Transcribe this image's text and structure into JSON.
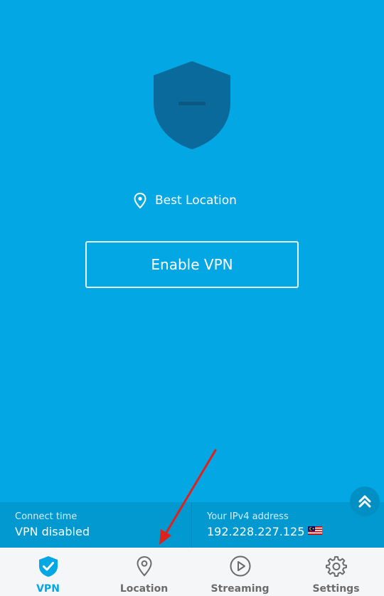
{
  "status": {
    "location_label": "Best Location",
    "enable_button_label": "Enable VPN"
  },
  "info_bar": {
    "connect_time_label": "Connect time",
    "connect_time_value": "VPN disabled",
    "ip_label": "Your IPv4 address",
    "ip_value": "192.228.227.125",
    "flag_icon": "malaysia-flag-icon"
  },
  "nav": {
    "items": [
      {
        "label": "VPN",
        "icon": "vpn-shield-check-icon",
        "active": true
      },
      {
        "label": "Location",
        "icon": "location-pin-icon",
        "active": false
      },
      {
        "label": "Streaming",
        "icon": "play-circle-icon",
        "active": false
      },
      {
        "label": "Settings",
        "icon": "gear-icon",
        "active": false
      }
    ]
  },
  "colors": {
    "background": "#03a7e3",
    "shield": "#0a6a9b",
    "info_bar": "#0299d0",
    "nav_background": "#f5f6f7",
    "active": "#03a7e3",
    "inactive": "#6b6b6b",
    "annotation": "#e0201b"
  }
}
